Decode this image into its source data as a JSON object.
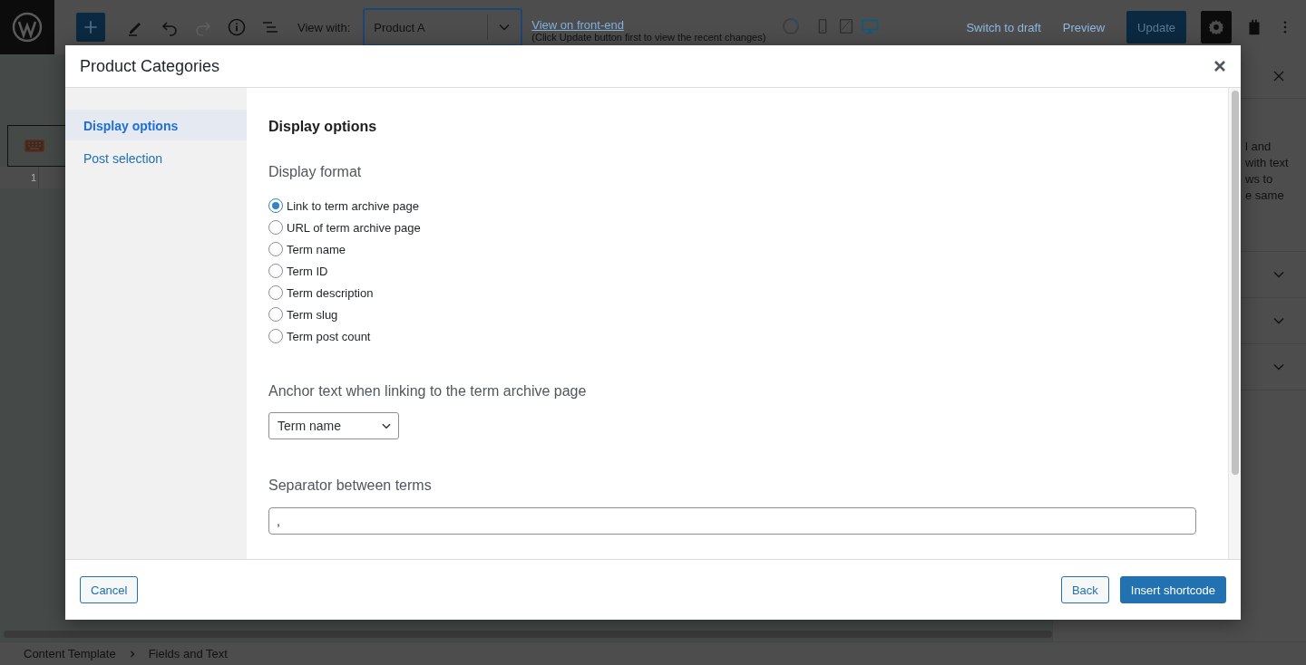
{
  "toolbar": {
    "view_with_label": "View with:",
    "view_with_value": "Product A",
    "front_end_link": "View on front-end",
    "front_end_note": "(Click Update button first to view the recent changes)",
    "preview_devices": [
      {
        "kind": "mobile",
        "selected": false
      },
      {
        "kind": "tablet",
        "selected": false
      },
      {
        "kind": "desktop",
        "selected": true
      }
    ],
    "actions": [
      {
        "kind": "link",
        "label": "Switch to draft"
      },
      {
        "kind": "link",
        "label": "Preview"
      },
      {
        "kind": "primary",
        "label": "Update"
      }
    ]
  },
  "editor": {
    "line_number": "1"
  },
  "sidebar": {
    "text_lines": [
      "l and",
      "with text",
      "ws to",
      "e same"
    ]
  },
  "breadcrumb": [
    "Content Template",
    "Fields and Text"
  ],
  "dialog": {
    "title": "Product Categories",
    "nav": [
      {
        "label": "Display options",
        "selected": true
      },
      {
        "label": "Post selection",
        "selected": false
      }
    ],
    "section_title": "Display options",
    "display_format": {
      "label": "Display format",
      "options": [
        {
          "label": "Link to term archive page",
          "selected": true
        },
        {
          "label": "URL of term archive page",
          "selected": false
        },
        {
          "label": "Term name",
          "selected": false
        },
        {
          "label": "Term ID",
          "selected": false
        },
        {
          "label": "Term description",
          "selected": false
        },
        {
          "label": "Term slug",
          "selected": false
        },
        {
          "label": "Term post count",
          "selected": false
        }
      ]
    },
    "anchor_text": {
      "label": "Anchor text when linking to the term archive page",
      "value": "Term name"
    },
    "separator": {
      "label": "Separator between terms",
      "value": ","
    },
    "buttons": [
      {
        "kind": "secondary",
        "label": "Cancel"
      },
      {
        "kind": "secondary",
        "label": "Back"
      },
      {
        "kind": "primary",
        "label": "Insert shortcode"
      }
    ]
  }
}
